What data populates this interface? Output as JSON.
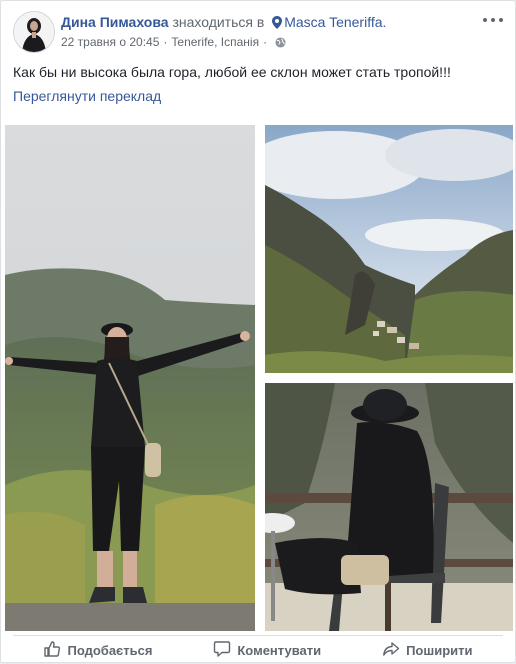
{
  "post": {
    "author": "Дина Пимахова",
    "is_at": "знаходиться в",
    "place": "Masca Teneriffa.",
    "date": "22 травня о 20:45",
    "location": "Tenerife, Іспанія",
    "text": "Как бы ни высока была гора, любой ее склон может стать тропой!!!",
    "translate_label": "Переглянути переклад"
  },
  "actions": {
    "like_label": "Подобається",
    "comment_label": "Коментувати",
    "share_label": "Поширити"
  },
  "icons": {
    "pin": "location-pin-icon",
    "globe": "globe-icon",
    "more": "more-options-icon",
    "like": "thumbs-up-icon",
    "comment": "comment-icon",
    "share": "share-icon"
  },
  "colors": {
    "link": "#365899",
    "muted": "#606770",
    "text": "#1d2129",
    "background": "#e9ebee"
  }
}
